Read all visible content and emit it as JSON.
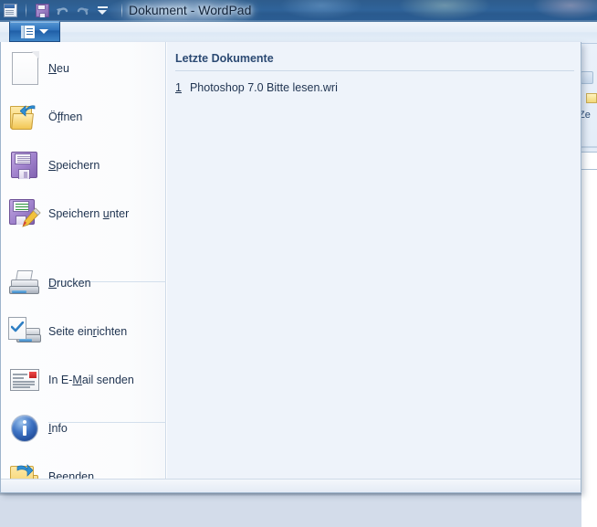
{
  "window": {
    "title": "Dokument - WordPad",
    "titlebar_color": "#2f639a"
  },
  "quick_access_toolbar": {
    "items": [
      {
        "name": "wordpad-icon",
        "label": "WordPad"
      },
      {
        "name": "save-icon",
        "label": "Speichern"
      },
      {
        "name": "undo-icon",
        "label": "Rückgängig"
      },
      {
        "name": "redo-icon",
        "label": "Wiederholen"
      },
      {
        "name": "customize-icon",
        "label": "Symbolleiste für den Schnellzugriff anpassen"
      }
    ]
  },
  "app_button": {
    "label": "WordPad-Menü",
    "accent": "#2f72bb"
  },
  "app_menu": {
    "items": [
      {
        "label_pre": "",
        "label_accel": "N",
        "label_post": "eu",
        "icon": "new-document-icon",
        "submenu": false
      },
      {
        "label_pre": "Ö",
        "label_accel": "f",
        "label_post": "fnen",
        "icon": "open-folder-icon",
        "submenu": false
      },
      {
        "label_pre": "",
        "label_accel": "S",
        "label_post": "peichern",
        "icon": "save-floppy-icon",
        "submenu": false
      },
      {
        "label_pre": "Speichern ",
        "label_accel": "u",
        "label_post": "nter",
        "icon": "save-as-icon",
        "submenu": true
      },
      {
        "label_pre": "",
        "label_accel": "D",
        "label_post": "rucken",
        "icon": "printer-icon",
        "submenu": true
      },
      {
        "label_pre": "Seite ein",
        "label_accel": "r",
        "label_post": "ichten",
        "icon": "page-setup-icon",
        "submenu": false
      },
      {
        "label_pre": "In E-",
        "label_accel": "M",
        "label_post": "ail senden",
        "icon": "mail-envelope-icon",
        "submenu": false
      },
      {
        "label_pre": "",
        "label_accel": "I",
        "label_post": "nfo",
        "icon": "info-icon",
        "submenu": false
      },
      {
        "label_pre": "",
        "label_accel": "B",
        "label_post": "eenden",
        "icon": "exit-folder-icon",
        "submenu": false
      }
    ]
  },
  "recent_documents": {
    "header": "Letzte Dokumente",
    "items": [
      {
        "number": "1",
        "name": "Photoshop 7.0 Bitte lesen.wri"
      }
    ]
  },
  "ribbon_fragment": {
    "label": "Ze"
  }
}
